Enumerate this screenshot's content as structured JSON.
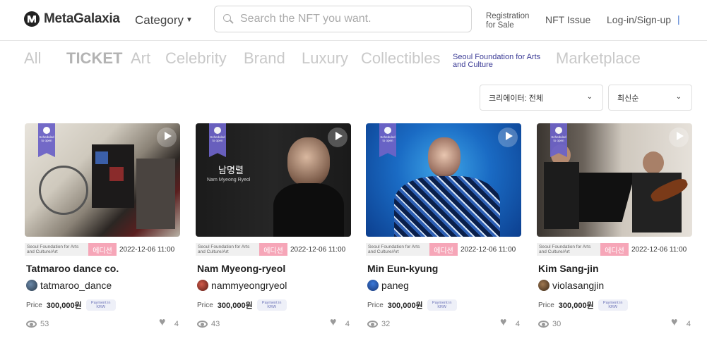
{
  "header": {
    "logo_text": "MetaGalaxia",
    "category_label": "Category",
    "search_placeholder": "Search the NFT you want.",
    "nav_registration": "Registration for Sale",
    "nav_nft_issue": "NFT Issue",
    "nav_login": "Log-in/Sign-up",
    "nav_separator": "|"
  },
  "tabs": {
    "all": "All",
    "ticket": "TICKET",
    "art": "Art",
    "celebrity": "Celebrity",
    "brand": "Brand",
    "luxury": "Luxury",
    "collectibles": "Collectibles",
    "seoul": "Seoul Foundation for Arts and Culture",
    "marketplace": "Marketplace"
  },
  "filters": {
    "creator": "크리에이터: 전체",
    "sort": "최신순"
  },
  "cards": [
    {
      "org": "Seoul Foundation for Arts and Culture/Art",
      "edition": "에디션",
      "date": "2022-12-06 11:00",
      "title": "Tatmaroo dance co.",
      "owner": "tatmaroo_dance",
      "price_label": "Price",
      "price": "300,000원",
      "payment": "Payment in KRW",
      "ribbon": "Scheduled to open",
      "views": "53",
      "likes": "4"
    },
    {
      "org": "Seoul Foundation for Arts and Culture/Art",
      "edition": "에디션",
      "date": "2022-12-06 11:00",
      "title": "Nam Myeong-ryeol",
      "owner": "nammyeongryeol",
      "price_label": "Price",
      "price": "300,000원",
      "payment": "Payment in KRW",
      "ribbon": "Scheduled to open",
      "thumb_name_ko": "남명렬",
      "thumb_name_en": "Nam Myeong Ryeol",
      "views": "43",
      "likes": "4"
    },
    {
      "org": "Seoul Foundation for Arts and Culture/Art",
      "edition": "에디션",
      "date": "2022-12-06 11:00",
      "title": "Min Eun-kyung",
      "owner": "paneg",
      "price_label": "Price",
      "price": "300,000원",
      "payment": "Payment in KRW",
      "ribbon": "Scheduled to open",
      "views": "32",
      "likes": "4"
    },
    {
      "org": "Seoul Foundation for Arts and Culture/Art",
      "edition": "에디션",
      "date": "2022-12-06 11:00",
      "title": "Kim Sang-jin",
      "owner": "violasangjin",
      "price_label": "Price",
      "price": "300,000원",
      "payment": "Payment in KRW",
      "ribbon": "Scheduled to open",
      "views": "30",
      "likes": "4"
    }
  ],
  "colors": {
    "ribbon": "#6d64c7",
    "edition_badge": "#f6a6b8",
    "seoul_tab": "#3b3b96",
    "payment_text": "#6d74b8"
  },
  "icons": [
    "logo-icon",
    "chevron-down-icon",
    "search-icon",
    "play-icon",
    "eye-icon",
    "heart-icon"
  ]
}
